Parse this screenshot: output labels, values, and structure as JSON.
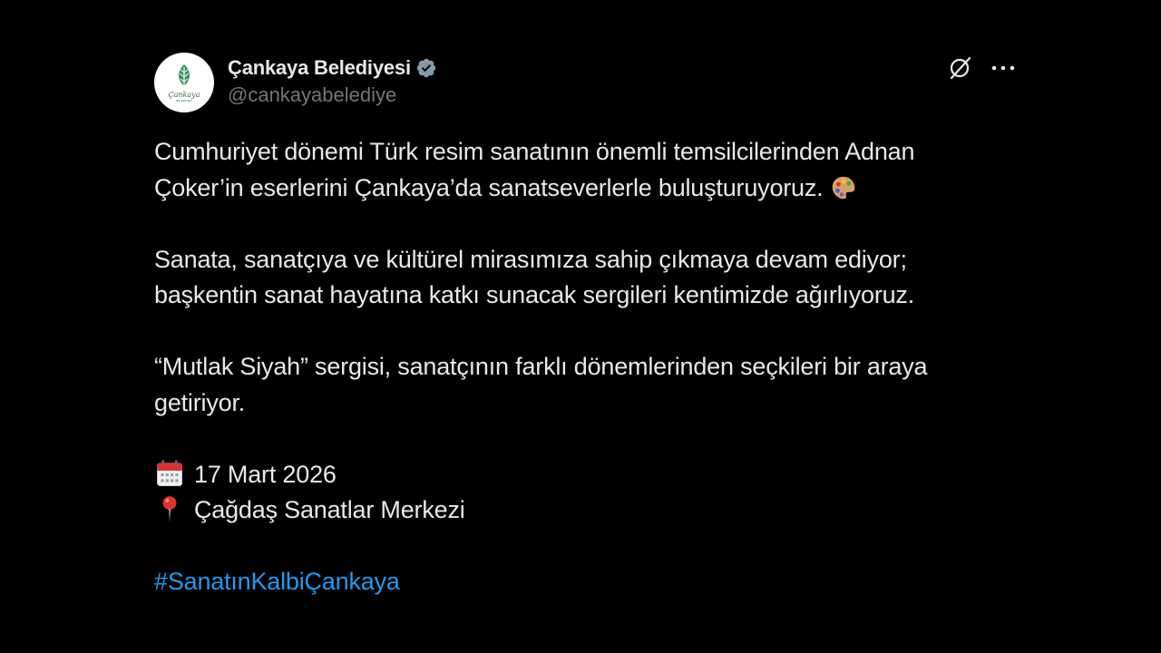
{
  "account": {
    "display_name": "Çankaya Belediyesi",
    "handle": "@cankayabelediye",
    "avatar_text": "Çankaya",
    "avatar_subtext": "BELEDİYESİ",
    "verified_icon": "verified-badge-icon"
  },
  "actions": {
    "grok_icon": "grok-icon",
    "more_icon": "more-icon"
  },
  "tweet": {
    "p1_line1": "Cumhuriyet dönemi Türk resim sanatının önemli temsilcilerinden Adnan",
    "p1_line2": "Çoker’in eserlerini Çankaya’da sanatseverlerle buluşturuyoruz.",
    "p2_line1": "Sanata, sanatçıya ve kültürel mirasımıza sahip çıkmaya devam ediyor;",
    "p2_line2": "başkentin sanat hayatına katkı sunacak sergileri kentimizde ağırlıyoruz.",
    "p3_line1": "“Mutlak Siyah” sergisi, sanatçının farklı dönemlerinden seçkileri bir araya",
    "p3_line2": "getiriyor.",
    "date": "17 Mart 2026",
    "location": "Çağdaş Sanatlar Merkezi",
    "hashtag": "#SanatınKalbiÇankaya"
  },
  "colors": {
    "background": "#000000",
    "text": "#e7e9ea",
    "secondary_text": "#71767b",
    "link": "#1d9bf0",
    "verified": "#829aab"
  }
}
